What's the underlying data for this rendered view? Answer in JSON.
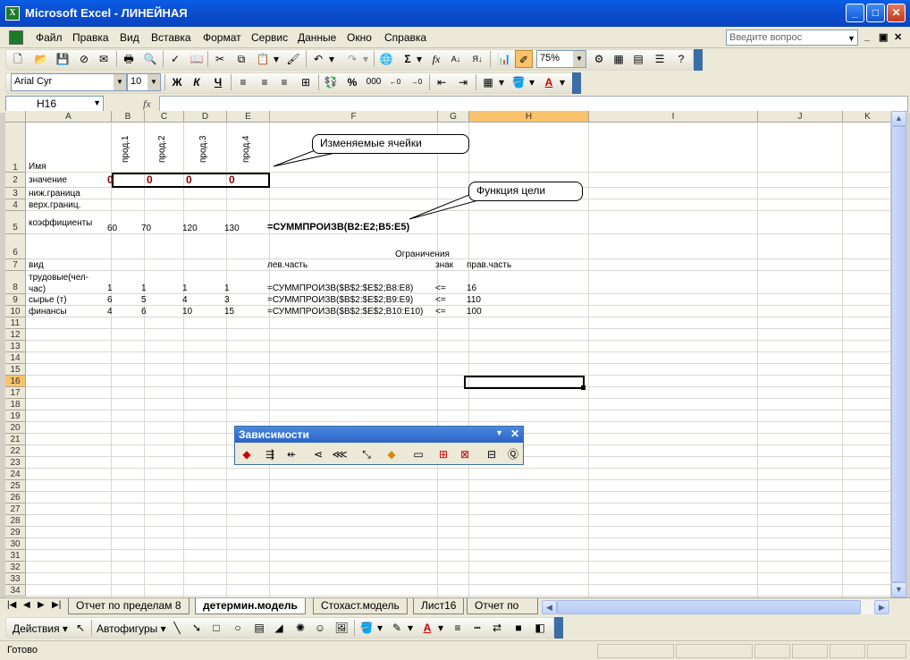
{
  "window": {
    "title": "Microsoft Excel - ЛИНЕЙНАЯ",
    "app_icon": "excel-icon"
  },
  "menu": {
    "items": [
      "Файл",
      "Правка",
      "Вид",
      "Вставка",
      "Формат",
      "Сервис",
      "Данные",
      "Окно",
      "Справка"
    ],
    "help_placeholder": "Введите вопрос"
  },
  "standard_toolbar": {
    "zoom": "75%"
  },
  "format_toolbar": {
    "font": "Arial Cyr",
    "size": "10",
    "bold": "Ж",
    "italic": "К",
    "underline": "Ч",
    "percent": "%",
    "thousands": "000"
  },
  "formula_bar": {
    "name_box": "H16",
    "fx": "fx",
    "formula": ""
  },
  "sheet": {
    "columns": [
      "A",
      "B",
      "C",
      "D",
      "E",
      "F",
      "G",
      "H",
      "I",
      "J",
      "K"
    ],
    "selected_column": "H",
    "selected_row": "16",
    "rows": [
      "1",
      "2",
      "3",
      "4",
      "5",
      "6",
      "7",
      "8",
      "9",
      "10",
      "11",
      "12",
      "13",
      "14",
      "15",
      "16",
      "17",
      "18",
      "19",
      "20",
      "21",
      "22",
      "23",
      "24",
      "25",
      "26",
      "27",
      "28",
      "29",
      "30",
      "31",
      "32",
      "33",
      "34"
    ],
    "cells": {
      "A1": "Имя",
      "B1": "прод.1",
      "C1": "прод.2",
      "D1": "прод.3",
      "E1": "прод.4",
      "A2": "значение",
      "B2": "0",
      "C2": "0",
      "D2": "0",
      "E2": "0",
      "A3": "ниж.граница",
      "A4": "верх.границ.",
      "A5": "коэффициенты",
      "B5": "60",
      "C5": "70",
      "D5": "120",
      "E5": "130",
      "F5": "=СУММПРОИЗВ(B2:E2;B5:E5)",
      "F6": "Ограничения",
      "A7": "вид",
      "F7": "лев.часть",
      "G7": "знак",
      "H7": "прав.часть",
      "A8a": "трудовые(чел-",
      "A8b": "час)",
      "B8": "1",
      "C8": "1",
      "D8": "1",
      "E8": "1",
      "F8": "=СУММПРОИЗВ($B$2:$E$2;B8:E8)",
      "G8": "<=",
      "H8": "16",
      "A9": "сырье (т)",
      "B9": "6",
      "C9": "5",
      "D9": "4",
      "E9": "3",
      "F9": "=СУММПРОИЗВ($B$2:$E$2;B9:E9)",
      "G9": "<=",
      "H9": "110",
      "A10": "финансы",
      "B10": "4",
      "C10": "6",
      "D10": "10",
      "E10": "15",
      "F10": "=СУММПРОИЗВ($B$2:$E$2;B10:E10)",
      "G10": "<=",
      "H10": "100"
    },
    "callouts": {
      "changeable": "Изменяемые ячейки",
      "objective": "Функция цели"
    }
  },
  "tabs": {
    "nav": [
      "|◀",
      "◀",
      "▶",
      "▶|"
    ],
    "items": [
      "Отчет по пределам 8",
      "детермин.модель",
      "Стохаст.модель",
      "Лист16",
      "Отчет по пр"
    ],
    "active": "детермин.модель"
  },
  "dependency_toolbar": {
    "title": "Зависимости"
  },
  "drawing_toolbar": {
    "actions": "Действия ▾",
    "autoshapes": "Автофигуры ▾"
  },
  "status": {
    "text": "Готово"
  },
  "colors": {
    "title_bar": "#0a5ee6",
    "selection_header": "#f9c36b",
    "value_red": "#800000"
  }
}
